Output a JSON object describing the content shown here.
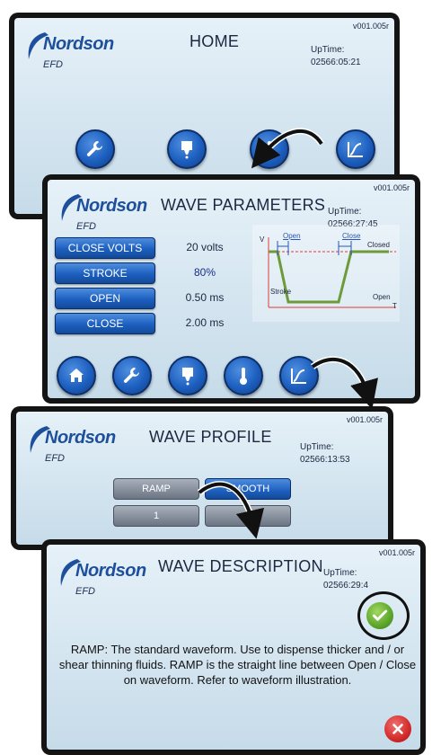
{
  "brand": {
    "name": "Nordson",
    "sub": "EFD"
  },
  "colors": {
    "accent": "#1d5fbf",
    "brand": "#1d4f9c",
    "ok": "#5ba62a",
    "cancel": "#d42a2a"
  },
  "home": {
    "title": "HOME",
    "version": "v001.005r",
    "uptime_label": "UpTime:",
    "uptime_value": "02566:05:21",
    "icons": [
      "wrench-icon",
      "dispenser-icon",
      "thermometer-icon",
      "waveform-icon"
    ]
  },
  "wave_params": {
    "title": "WAVE PARAMETERS",
    "version": "v001.005r",
    "uptime_label": "UpTime:",
    "uptime_value": "02566:27:45",
    "rows": [
      {
        "label": "CLOSE VOLTS",
        "value": "20 volts"
      },
      {
        "label": "STROKE",
        "value": "80%"
      },
      {
        "label": "OPEN",
        "value": "0.50 ms"
      },
      {
        "label": "CLOSE",
        "value": "2.00 ms"
      }
    ],
    "diagram": {
      "v": "V",
      "t": "T",
      "open": "Open",
      "close": "Close",
      "closed": "Closed",
      "stroke": "Stroke",
      "open_end": "Open"
    },
    "icons": [
      "home-icon",
      "wrench-icon",
      "dispenser-icon",
      "thermometer-icon",
      "waveform-icon"
    ]
  },
  "wave_profile": {
    "title": "WAVE PROFILE",
    "version": "v001.005r",
    "uptime_label": "UpTime:",
    "uptime_value": "02566:13:53",
    "options": [
      "RAMP",
      "SMOOTH"
    ],
    "selected": "SMOOTH",
    "row2": [
      "1"
    ]
  },
  "wave_desc": {
    "title": "WAVE DESCRIPTION",
    "version": "v001.005r",
    "uptime_label": "UpTime:",
    "uptime_value": "02566:29:4",
    "text": "RAMP: The standard waveform. Use to dispense thicker and / or shear thinning fluids. RAMP is the straight line between Open / Close on waveform. Refer to waveform illustration."
  }
}
